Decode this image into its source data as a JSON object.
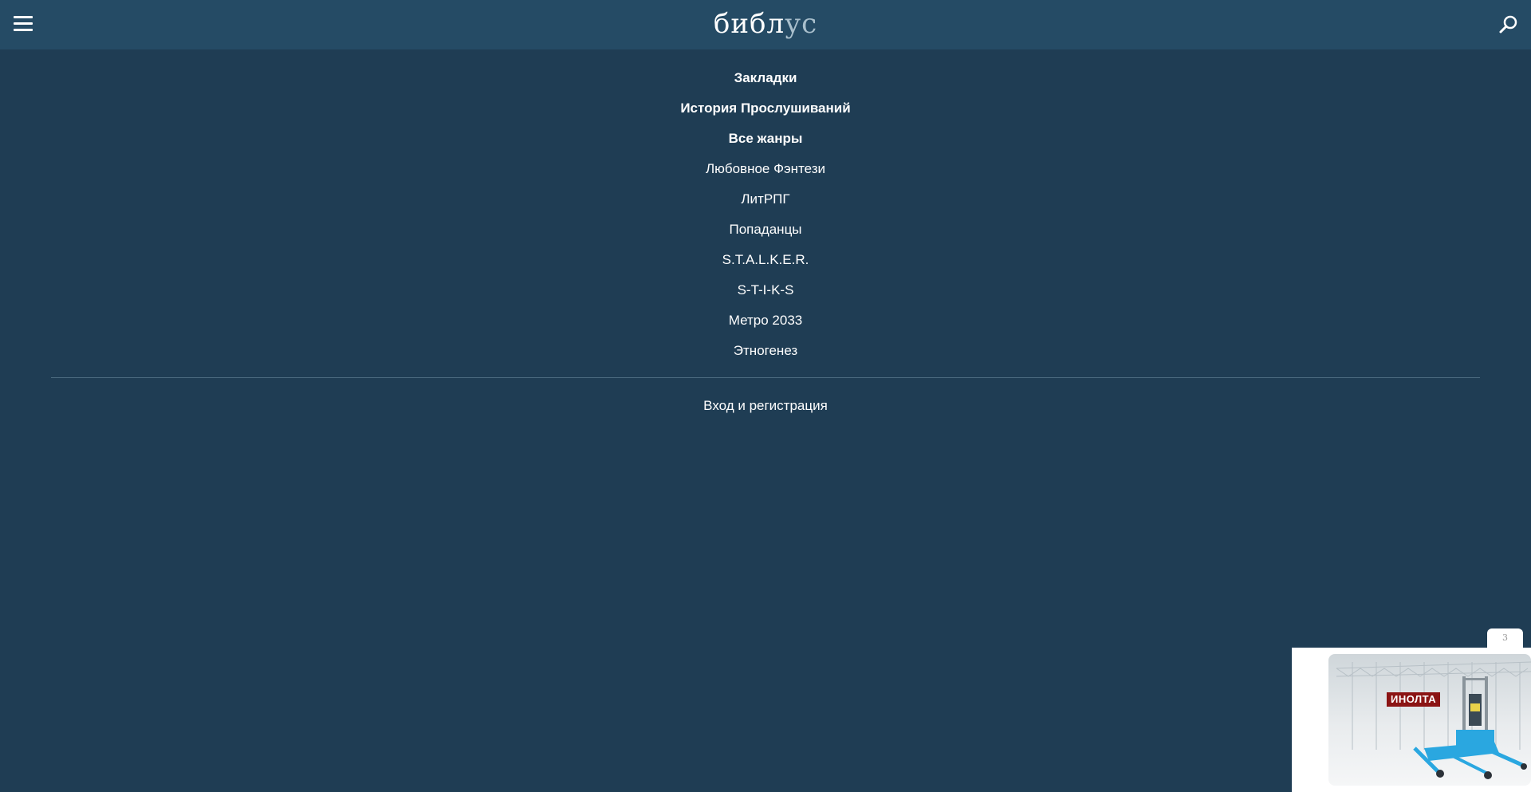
{
  "header": {
    "logo_part1": "библ",
    "logo_part2": "ус",
    "menu_icon": "hamburger-menu-icon",
    "search_icon": "search-icon"
  },
  "menu": {
    "items": [
      {
        "label": "Закладки",
        "bold": true
      },
      {
        "label": "История Прослушиваний",
        "bold": true
      },
      {
        "label": "Все жанры",
        "bold": true
      },
      {
        "label": "Любовное Фэнтези",
        "bold": false
      },
      {
        "label": "ЛитРПГ",
        "bold": false
      },
      {
        "label": "Попаданцы",
        "bold": false
      },
      {
        "label": "S.T.A.L.K.E.R.",
        "bold": false
      },
      {
        "label": "S-T-I-K-S",
        "bold": false
      },
      {
        "label": "Метро 2033",
        "bold": false
      },
      {
        "label": "Этногенез",
        "bold": false
      }
    ]
  },
  "footer": {
    "login_label": "Вход и регистрация"
  },
  "ad": {
    "counter": "3",
    "brand": "ИНОЛТА"
  },
  "colors": {
    "background": "#1f3d54",
    "header": "#254b65",
    "logo_accent": "#a9bfcc",
    "ad_brand": "#8b1414",
    "lift_blue": "#2aa7e0"
  }
}
